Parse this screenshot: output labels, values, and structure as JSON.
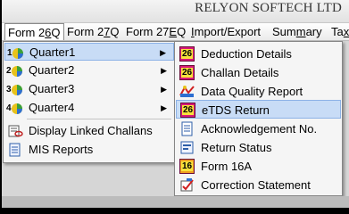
{
  "app": {
    "brand": "RELYON SOFTECH LTD"
  },
  "menubar": [
    {
      "label": "Form 26Q",
      "underline": "6",
      "active": true
    },
    {
      "label": "Form 27Q",
      "underline": "7"
    },
    {
      "label": "Form 27EQ",
      "underline": "E"
    },
    {
      "label": "Import/Export",
      "underline": "I"
    },
    {
      "label": "Summary",
      "underline": "m"
    },
    {
      "label": "Tax",
      "underline": "x"
    }
  ],
  "dropdown": {
    "items": [
      {
        "label": "Quarter1",
        "num": "1",
        "highlighted": true,
        "has_arrow": true
      },
      {
        "label": "Quarter2",
        "num": "2",
        "has_arrow": true
      },
      {
        "label": "Quarter3",
        "num": "3",
        "has_arrow": true
      },
      {
        "label": "Quarter4",
        "num": "4",
        "has_arrow": true
      },
      {
        "label": "Display Linked Challans"
      },
      {
        "label": "MIS Reports"
      }
    ],
    "arrow": "▶"
  },
  "submenu": {
    "items": [
      {
        "label": "Deduction Details",
        "icon": "form-26-icon",
        "badge": "26"
      },
      {
        "label": "Challan Details",
        "icon": "form-26-icon",
        "badge": "26"
      },
      {
        "label": "Data Quality Report",
        "icon": "data-quality-icon"
      },
      {
        "label": "eTDS Return",
        "icon": "form-26-icon",
        "badge": "26",
        "highlighted": true
      },
      {
        "label": "Acknowledgement No.",
        "icon": "acknowledgement-icon"
      },
      {
        "label": "Return Status",
        "icon": "return-status-icon"
      },
      {
        "label": "Form 16A",
        "icon": "form-16a-icon",
        "badge": "16"
      },
      {
        "label": "Correction Statement",
        "icon": "correction-icon"
      }
    ]
  },
  "colors": {
    "highlight_bg": "#c8dcf6",
    "highlight_border": "#8cb2e6",
    "menu_bg": "#f5f5f5"
  }
}
